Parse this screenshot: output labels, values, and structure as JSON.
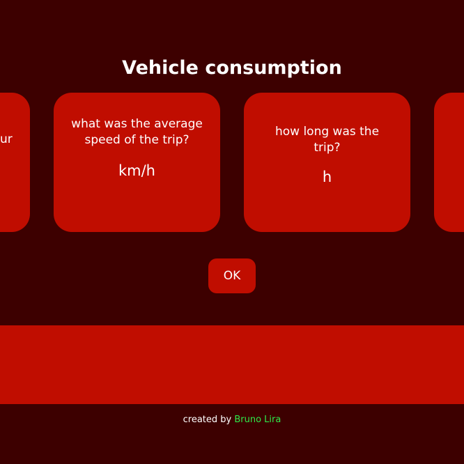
{
  "header": {
    "title": "Vehicle consumption"
  },
  "cards": [
    {
      "question_fragment": "ur"
    },
    {
      "question": "what was the average speed of the trip?",
      "unit": "km/h"
    },
    {
      "question": "how long was the trip?",
      "unit": "h"
    }
  ],
  "ok_label": "OK",
  "footer": {
    "prefix": "created by ",
    "author": "Bruno Lira"
  },
  "colors": {
    "background": "#3d0000",
    "card": "#c00d00",
    "author": "#2ee84a"
  }
}
